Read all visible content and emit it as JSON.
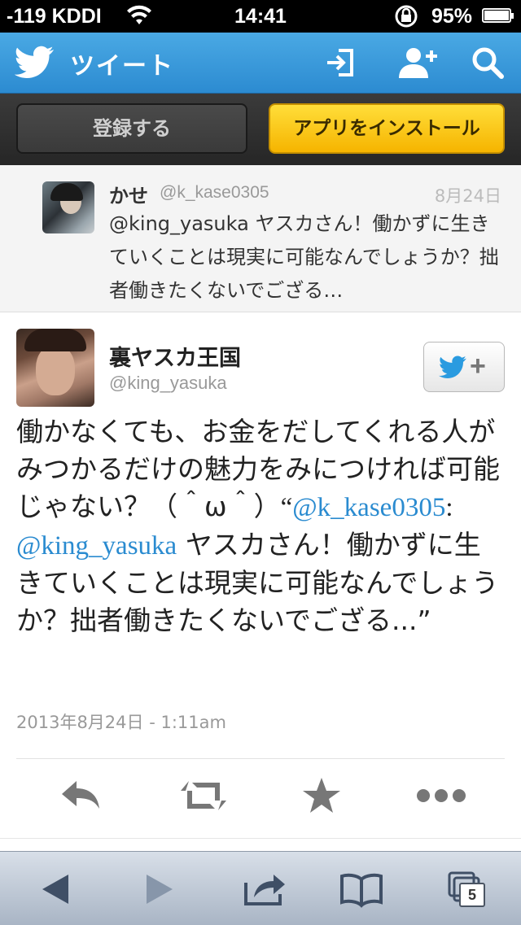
{
  "status_bar": {
    "carrier": "-119 KDDI",
    "time": "14:41",
    "battery": "95%"
  },
  "header": {
    "title": "ツイート"
  },
  "action_bar": {
    "register_label": "登録する",
    "install_label": "アプリをインストール"
  },
  "reply_tweet": {
    "name": "かせ",
    "handle": "@k_kase0305",
    "date": "8月24日",
    "text": "@king_yasuka ヤスカさん！働かずに生きていくことは現実に可能なんでしょうか？拙者働きたくないでござる…"
  },
  "main_tweet": {
    "name": "裏ヤスカ王国",
    "handle": "@king_yasuka",
    "text_main": "働かなくても、お金をだしてくれる人がみつかるだけの魅力をみにつければ可能じゃない？（＾ω＾）",
    "quote_open": "“",
    "mention_1": "@k_kase0305",
    "sep": ": ",
    "mention_2": "@king_yasuka",
    "quoted_text": " ヤスカさん！働かずに生きていくことは現実に可能なんでしょうか？拙者働きたくないでござる...”",
    "timestamp": "2013年8月24日 - 1:11am"
  },
  "tab_count": "5",
  "colors": {
    "header_blue": "#2c8bd1",
    "mention_blue": "#2a8bd0",
    "install_yellow": "#f6b400"
  }
}
